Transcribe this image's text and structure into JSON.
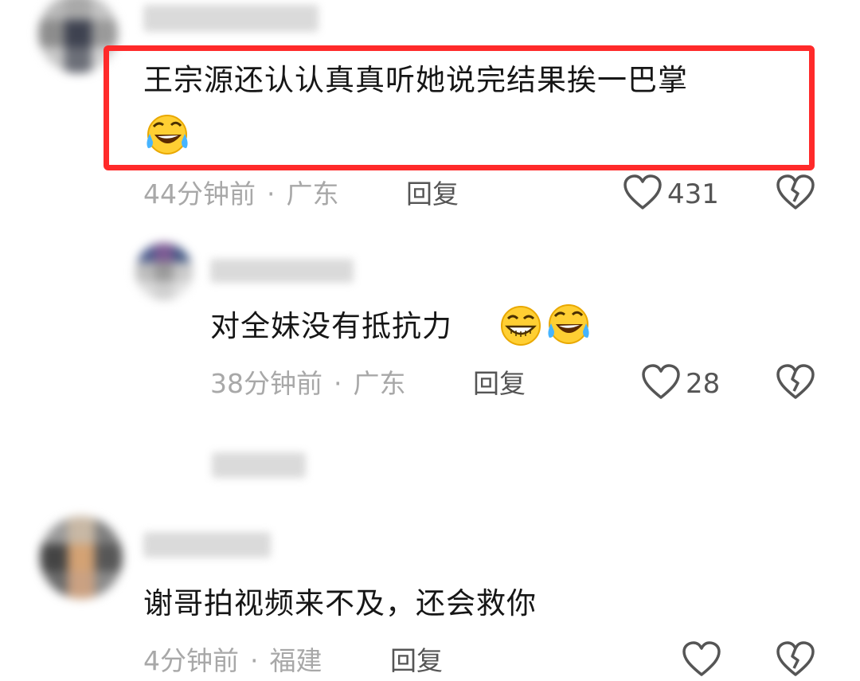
{
  "comments": [
    {
      "text": "王宗源还认认真真听她说完结果挨一巴掌",
      "emoji": "laughing-with-tears",
      "time": "44分钟前",
      "location": "广东",
      "reply_label": "回复",
      "likes": "431",
      "highlighted": true,
      "highlight_color": "#ff2a2a",
      "replies": [
        {
          "text": "对全妹没有抵抗力",
          "emojis": [
            "grinning-face",
            "laughing-with-tears"
          ],
          "time": "38分钟前",
          "location": "广东",
          "reply_label": "回复",
          "likes": "28"
        }
      ]
    },
    {
      "text": "谢哥拍视频来不及，还会救你",
      "time": "4分钟前",
      "location": "福建",
      "reply_label": "回复",
      "likes": ""
    }
  ],
  "separator": "·",
  "colors": {
    "meta": "#a8a8a8",
    "action": "#555555",
    "text": "#161616"
  }
}
